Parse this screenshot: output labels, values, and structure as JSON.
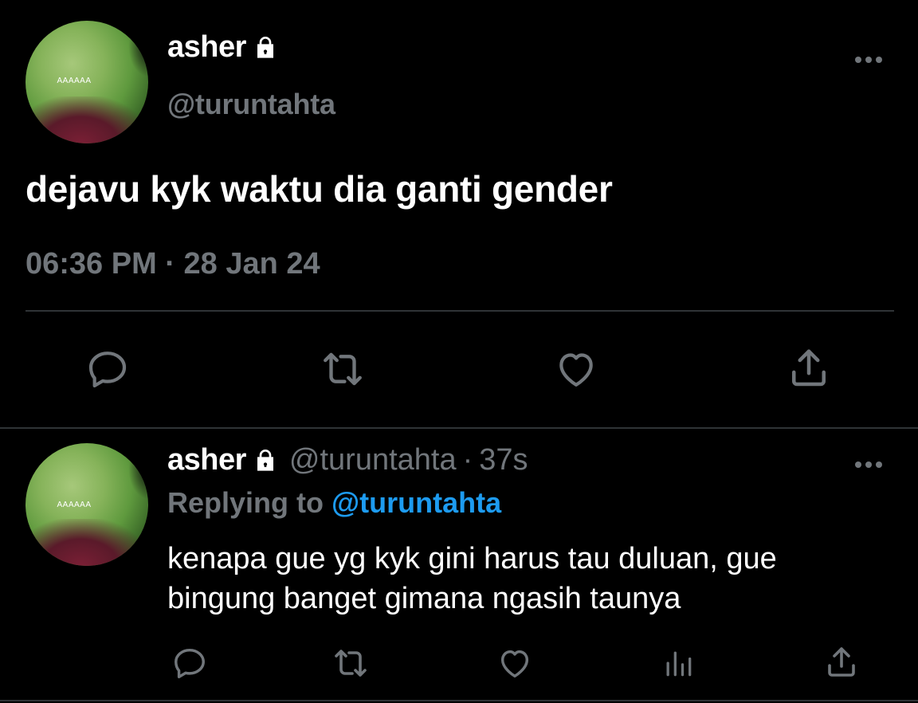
{
  "main_tweet": {
    "avatar_text": "AAAAAA",
    "display_name": "asher",
    "handle": "@turuntahta",
    "text": "dejavu kyk waktu dia ganti gender",
    "timestamp": "06:36 PM · 28 Jan 24",
    "actions": [
      "reply-icon",
      "retweet-icon",
      "like-icon",
      "share-icon"
    ]
  },
  "reply_tweet": {
    "avatar_text": "AAAAAA",
    "display_name": "asher",
    "handle": "@turuntahta",
    "separator": "·",
    "time_ago": "37s",
    "replying_label": "Replying to",
    "replying_to": "@turuntahta",
    "text": "kenapa gue yg kyk gini harus tau duluan, gue bingung banget gimana ngasih taunya",
    "actions": [
      "reply-icon",
      "retweet-icon",
      "like-icon",
      "analytics-icon",
      "share-icon"
    ]
  },
  "colors": {
    "background": "#000000",
    "text_primary": "#ffffff",
    "text_secondary": "#71767b",
    "accent": "#1d9bf0",
    "divider": "#2f3336"
  }
}
